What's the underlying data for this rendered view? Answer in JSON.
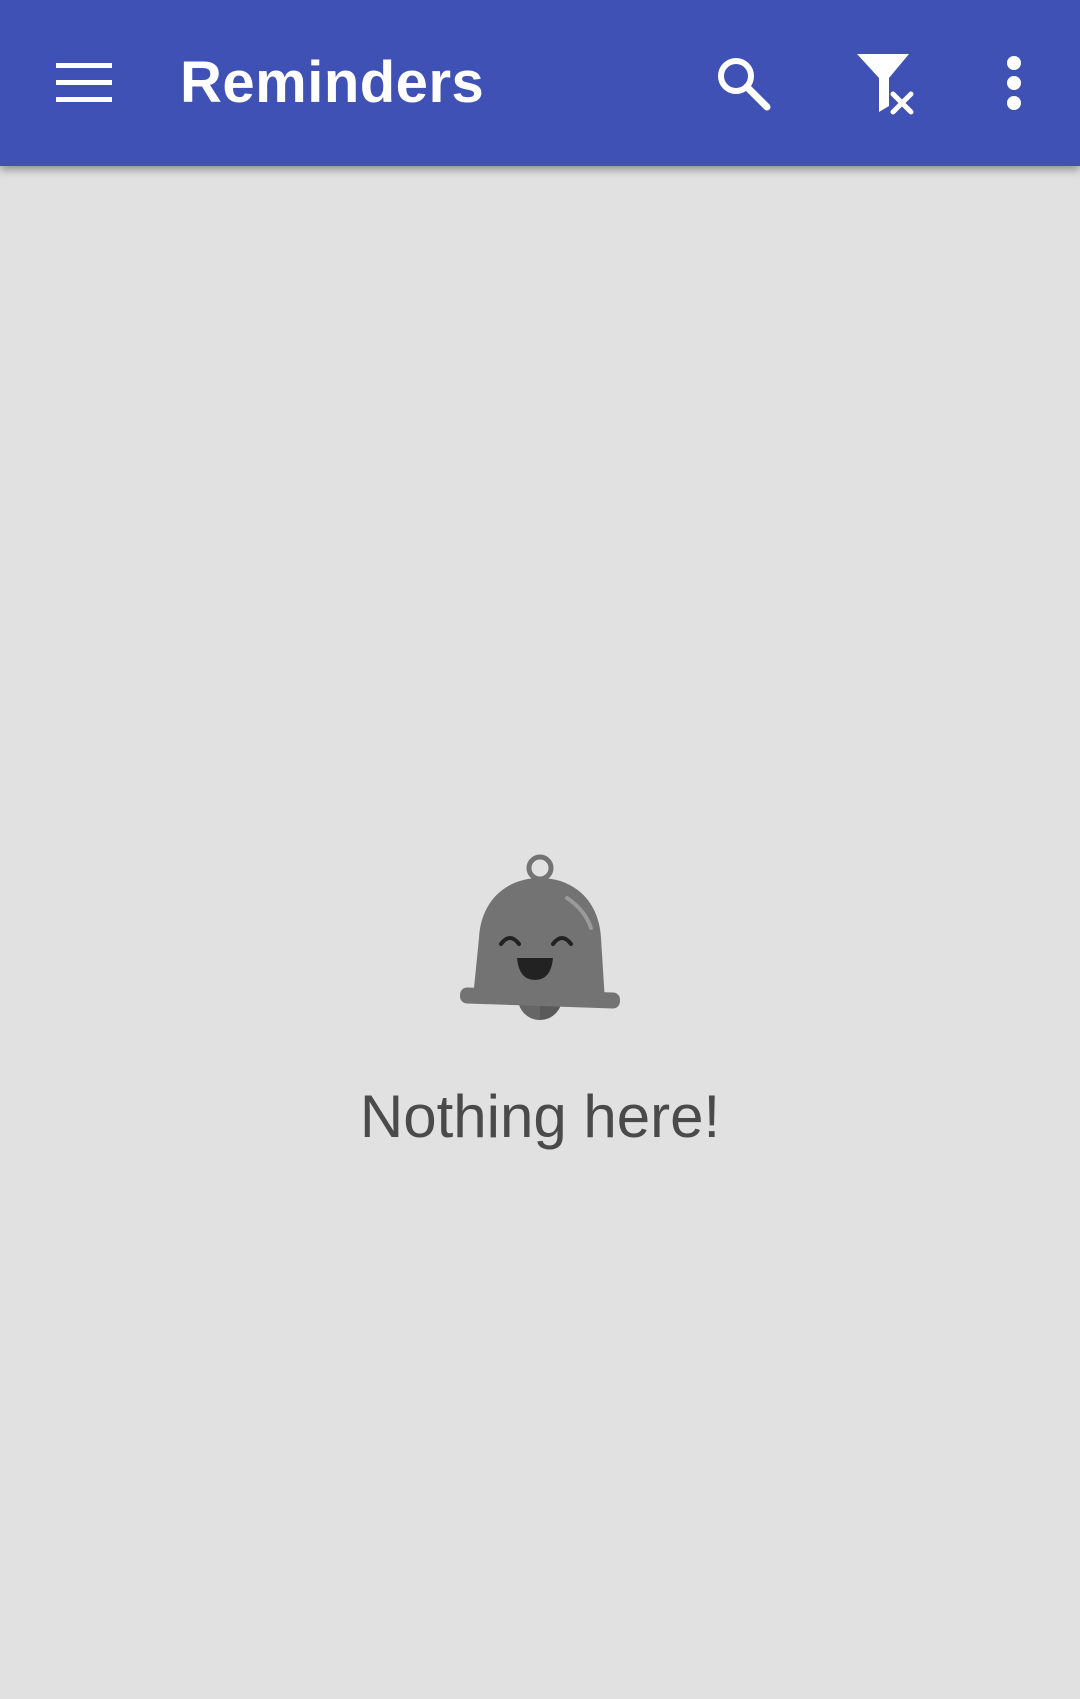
{
  "app_bar": {
    "title": "Reminders",
    "background_color": "#3f51b5",
    "icons": [
      "menu-icon",
      "search-icon",
      "filter-clear-icon",
      "more-vert-icon"
    ]
  },
  "empty_state": {
    "message": "Nothing here!",
    "icon": "happy-bell-icon",
    "icon_color": "#737373"
  },
  "colors": {
    "background": "#e1e1e1",
    "text": "#4a4a4a"
  }
}
